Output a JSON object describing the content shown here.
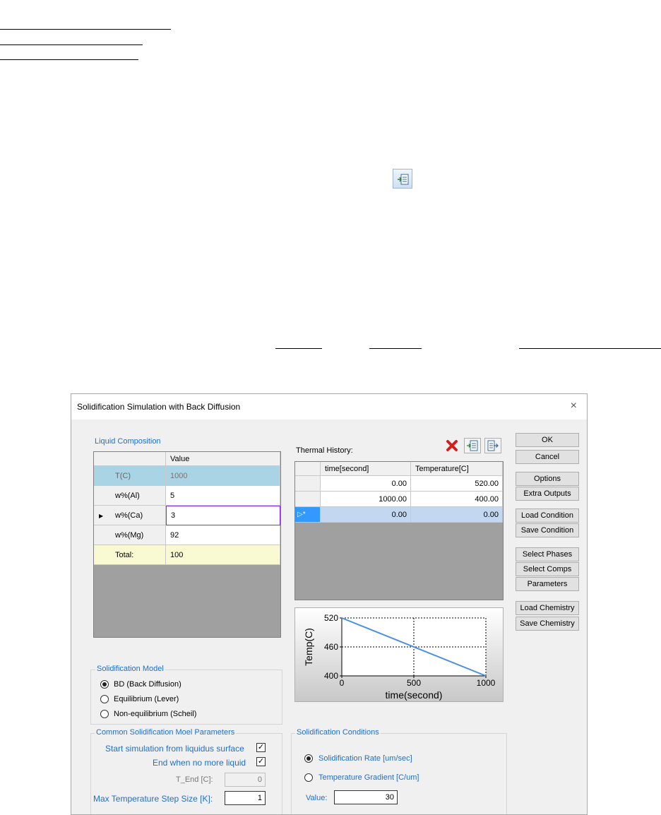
{
  "window": {
    "title": "Solidification Simulation with Back Diffusion",
    "close_glyph": "×"
  },
  "liquid_composition": {
    "label": "Liquid Composition",
    "header": "Value",
    "rows": [
      {
        "name": "T(C)",
        "value": "1000"
      },
      {
        "name": "w%(Al)",
        "value": "5"
      },
      {
        "name": "w%(Ca)",
        "value": "3"
      },
      {
        "name": "w%(Mg)",
        "value": "92"
      },
      {
        "name": "Total:",
        "value": "100"
      }
    ]
  },
  "thermal_history": {
    "label": "Thermal History:",
    "headers": [
      "time[second]",
      "Temperature[C]"
    ],
    "rows": [
      {
        "time": "0.00",
        "temp": "520.00"
      },
      {
        "time": "1000.00",
        "temp": "400.00"
      },
      {
        "time": "0.00",
        "temp": "0.00"
      }
    ],
    "new_row_marker": "▷*"
  },
  "chart_data": {
    "type": "line",
    "x": [
      0,
      1000
    ],
    "y": [
      520,
      400
    ],
    "xlabel": "time(second)",
    "ylabel": "Temp(C)",
    "xlim": [
      0,
      1000
    ],
    "ylim": [
      400,
      520
    ],
    "xticks": [
      "0",
      "500",
      "1000"
    ],
    "yticks": [
      "400",
      "460",
      "520"
    ],
    "line_color": "#4a90e2",
    "grid": true
  },
  "buttons": {
    "ok": "OK",
    "cancel": "Cancel",
    "options": "Options",
    "extra_outputs": "Extra Outputs",
    "load_condition": "Load Condition",
    "save_condition": "Save Condition",
    "select_phases": "Select Phases",
    "select_comps": "Select Comps",
    "parameters": "Parameters",
    "load_chemistry": "Load Chemistry",
    "save_chemistry": "Save Chemistry"
  },
  "solidification_model": {
    "label": "Solidification Model",
    "options": [
      "BD (Back Diffusion)",
      "Equilibrium (Lever)",
      "Non-equilibrium (Scheil)"
    ],
    "selected_index": 0
  },
  "common_params": {
    "label": "Common Solidification Moel Parameters",
    "start_liquidus": "Start simulation from liquidus surface",
    "end_no_liquid": "End when no more liquid",
    "t_end_label": "T_End [C]:",
    "t_end_value": "0",
    "max_step_label": "Max Temperature Step Size [K]:",
    "max_step_value": "1",
    "check_glyph": "✓"
  },
  "solidification_conditions": {
    "label": "Solidification Conditions",
    "rate": "Solidification Rate [um/sec]",
    "gradient": "Temperature Gradient [C/um]",
    "value_label": "Value:",
    "value": "30"
  }
}
